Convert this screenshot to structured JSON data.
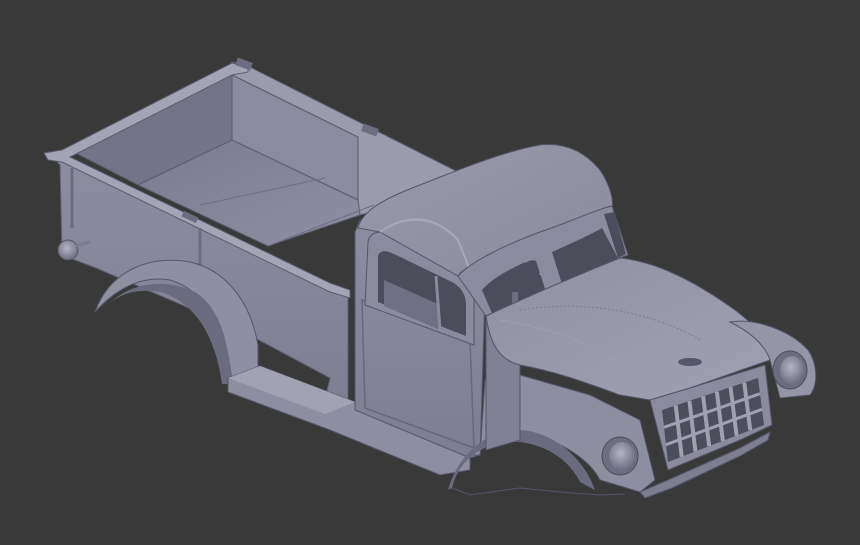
{
  "viewport": {
    "background": "#393939",
    "model": {
      "subject": "pickup-truck-body",
      "base_color": "#8a8b9c",
      "shadow_color": "#5f6072",
      "highlight_color": "#a9aab9",
      "dark_color": "#484a57"
    }
  }
}
